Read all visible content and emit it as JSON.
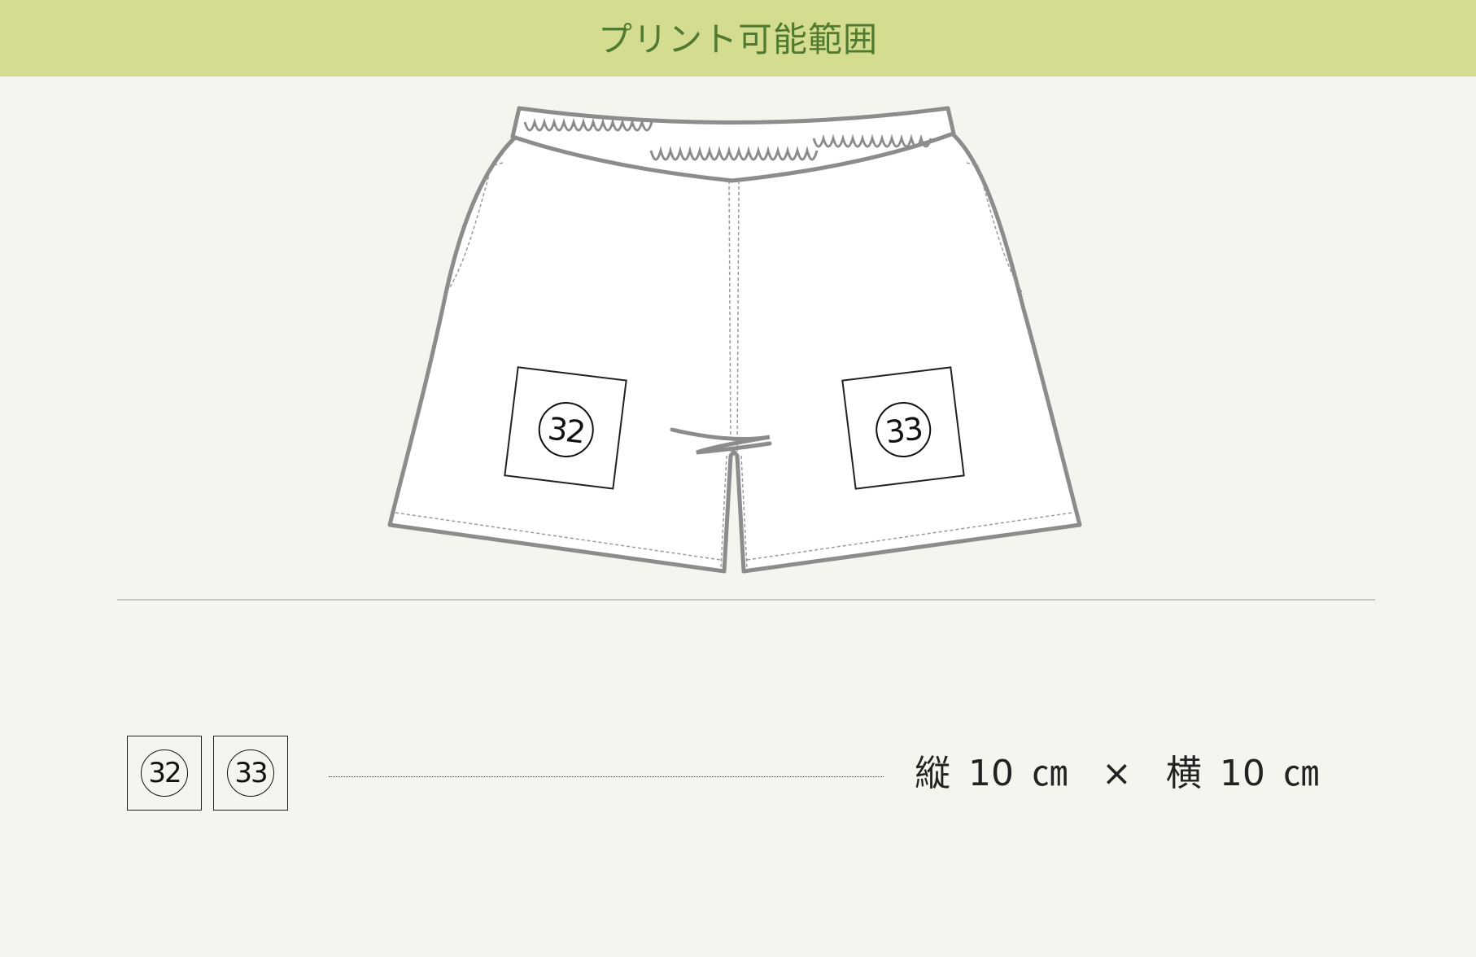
{
  "header": {
    "title": "プリント可能範囲"
  },
  "print_areas": [
    {
      "id": "32"
    },
    {
      "id": "33"
    }
  ],
  "size": {
    "height_label": "縦",
    "height_value": "10",
    "height_unit": "㎝",
    "times": "×",
    "width_label": "横",
    "width_value": "10",
    "width_unit": "㎝"
  },
  "colors": {
    "header_bg": "#d4dc8f",
    "header_text": "#4f7a30",
    "page_bg": "#f5f4ef",
    "garment_outline": "#8c8c8c"
  }
}
